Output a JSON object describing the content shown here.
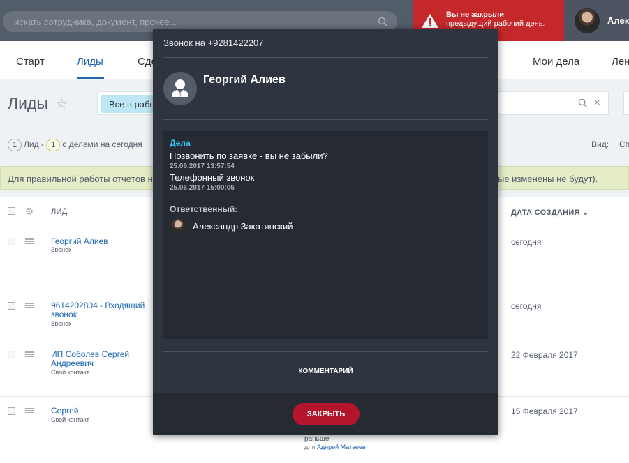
{
  "header": {
    "search_placeholder": "искать сотрудника, документ, прочее...",
    "alert_line1": "Вы не закрыли",
    "alert_line2": "предыдущий рабочий день.",
    "user_name": "Алек"
  },
  "nav": {
    "tabs": [
      {
        "label": "Старт"
      },
      {
        "label": "Лиды"
      },
      {
        "label": "Сде"
      },
      {
        "label": "Мои дела"
      },
      {
        "label": "Лен"
      }
    ]
  },
  "page": {
    "title": "Лиды",
    "filter_chip": "Все в работе",
    "counter_lead_count": "1",
    "counter_lead_text": "Лид -",
    "counter_deals_count": "1",
    "counter_deals_text": "с делами на сегодня",
    "view_label": "Вид:",
    "view_value": "Сп",
    "notice_left": "Для правильной работы отчётов не",
    "notice_right": "ые изменены не будут)."
  },
  "table": {
    "col_lead": "ЛИД",
    "col_date": "ДАТА СОЗДАНИЯ",
    "rows": [
      {
        "name": "Георгий Алиев",
        "source": "Звонок",
        "date": "сегодня"
      },
      {
        "name": "9614202804 - Входящий звонок",
        "source": "Звонок",
        "date": "сегодня"
      },
      {
        "name": "ИП Соболев Сергей Андреевич",
        "source": "Свой контакт",
        "date": "22 Февраля 2017"
      },
      {
        "name": "Сергей",
        "source": "Свой контакт",
        "date": "15 Февраля 2017"
      }
    ],
    "extra_text": "раньше",
    "extra_for": "для",
    "extra_person": "Аднрей Матвеев"
  },
  "modal": {
    "title": "Звонок на +9281422207",
    "contact_name": "Георгий Алиев",
    "section_label": "Дела",
    "tasks": [
      {
        "title": "Позвонить по заявке - вы не забыли?",
        "datetime": "25.06.2017 13:57:54"
      },
      {
        "title": "Телефонный звонок",
        "datetime": "25.06.2017 15:00:06"
      }
    ],
    "responsible_label": "Ответственный:",
    "responsible_name": "Александр Закатянский",
    "comment_link": "КОММЕНТАРИЙ",
    "close_button": "ЗАКРЫТЬ"
  },
  "colors": {
    "accent_blue": "#2067b0",
    "alert_red": "#c4282b",
    "close_red": "#b3162c",
    "section_cyan": "#2fc6f6"
  }
}
